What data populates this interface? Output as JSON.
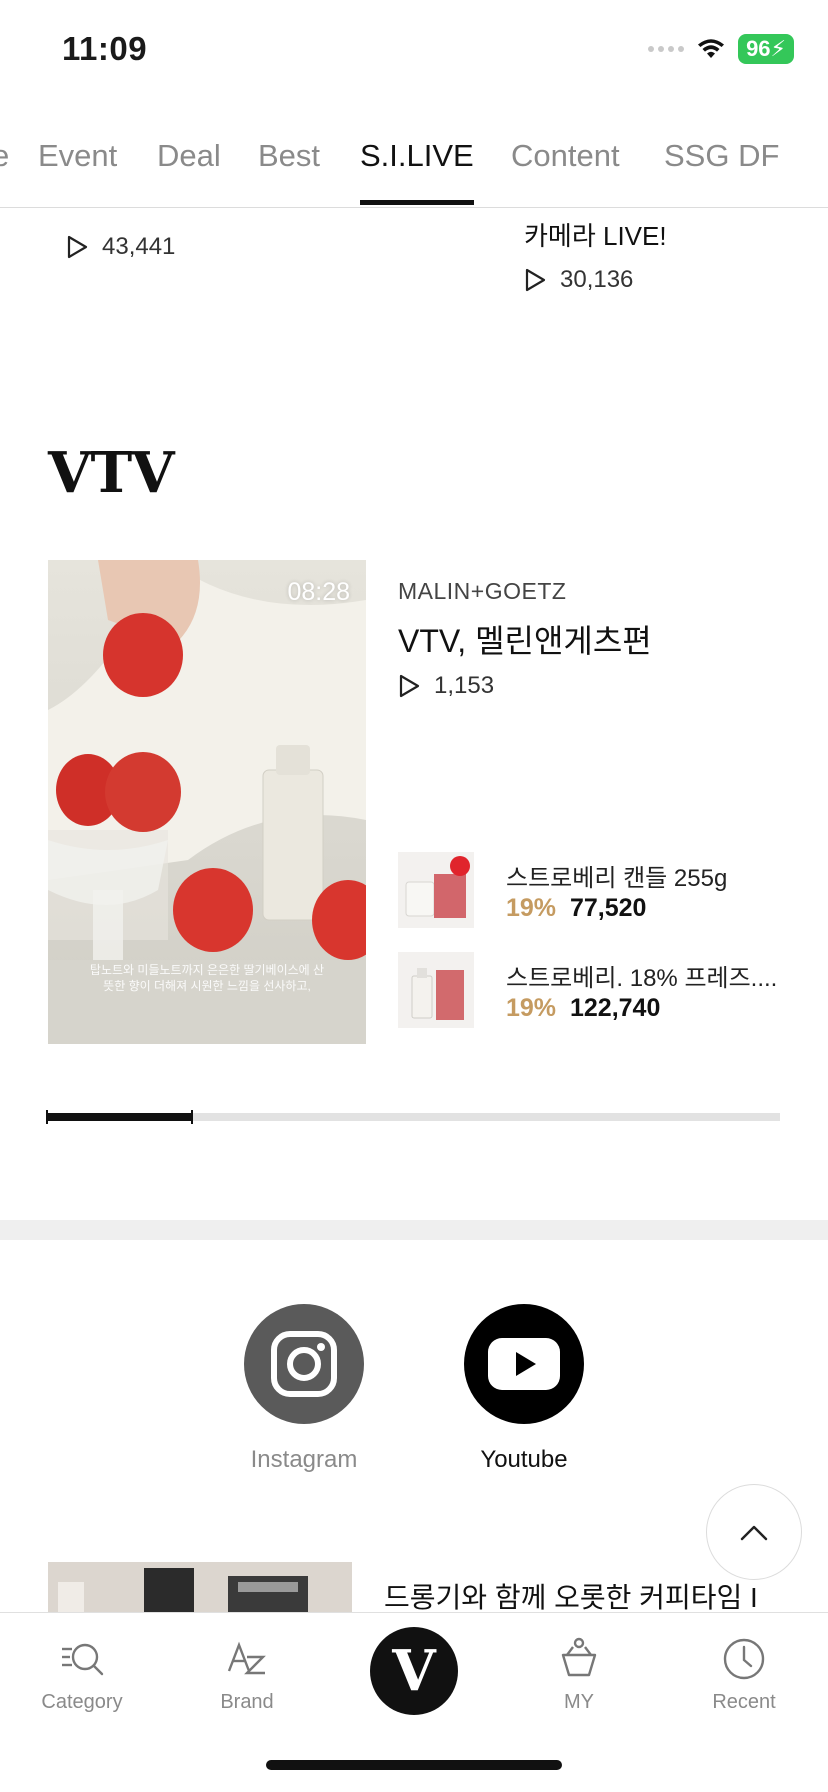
{
  "status_bar": {
    "time": "11:09",
    "battery": "96"
  },
  "tabs": {
    "items": [
      {
        "label": "Event"
      },
      {
        "label": "Deal"
      },
      {
        "label": "Best"
      },
      {
        "label": "S.I.LIVE"
      },
      {
        "label": "Content"
      },
      {
        "label": "SSG DF"
      }
    ],
    "active": "S.I.LIVE"
  },
  "prev_live": {
    "right_title": "카메라 LIVE!",
    "left_views": "43,441",
    "right_views": "30,136"
  },
  "vtv": {
    "section_title": "VTV",
    "video": {
      "duration": "08:28",
      "caption": "탑노트와 미들노트까지 은은한 딸기베이스에 산뜻한 향이 더해져 시원한 느낌을 선사하고,",
      "brand": "MALIN+GOETZ",
      "title": "VTV, 멜린앤게츠편",
      "views": "1,153"
    },
    "products": [
      {
        "name": "스트로베리 캔들 255g",
        "discount": "19%",
        "price": "77,520"
      },
      {
        "name": "스트로베리. 18% 프레즈....",
        "discount": "19%",
        "price": "122,740"
      }
    ],
    "carousel_progress": 0.2
  },
  "social": {
    "instagram_label": "Instagram",
    "youtube_label": "Youtube"
  },
  "teaser": {
    "title": "드롱기와 함께 오롯한 커피타임 I"
  },
  "bottom_nav": {
    "items": [
      {
        "label": "Category",
        "icon": "category-icon"
      },
      {
        "label": "Brand",
        "icon": "brand-az-icon"
      },
      {
        "label": "",
        "icon": "v-home-logo"
      },
      {
        "label": "MY",
        "icon": "basket-icon"
      },
      {
        "label": "Recent",
        "icon": "clock-icon"
      }
    ],
    "center_logo": "V"
  }
}
